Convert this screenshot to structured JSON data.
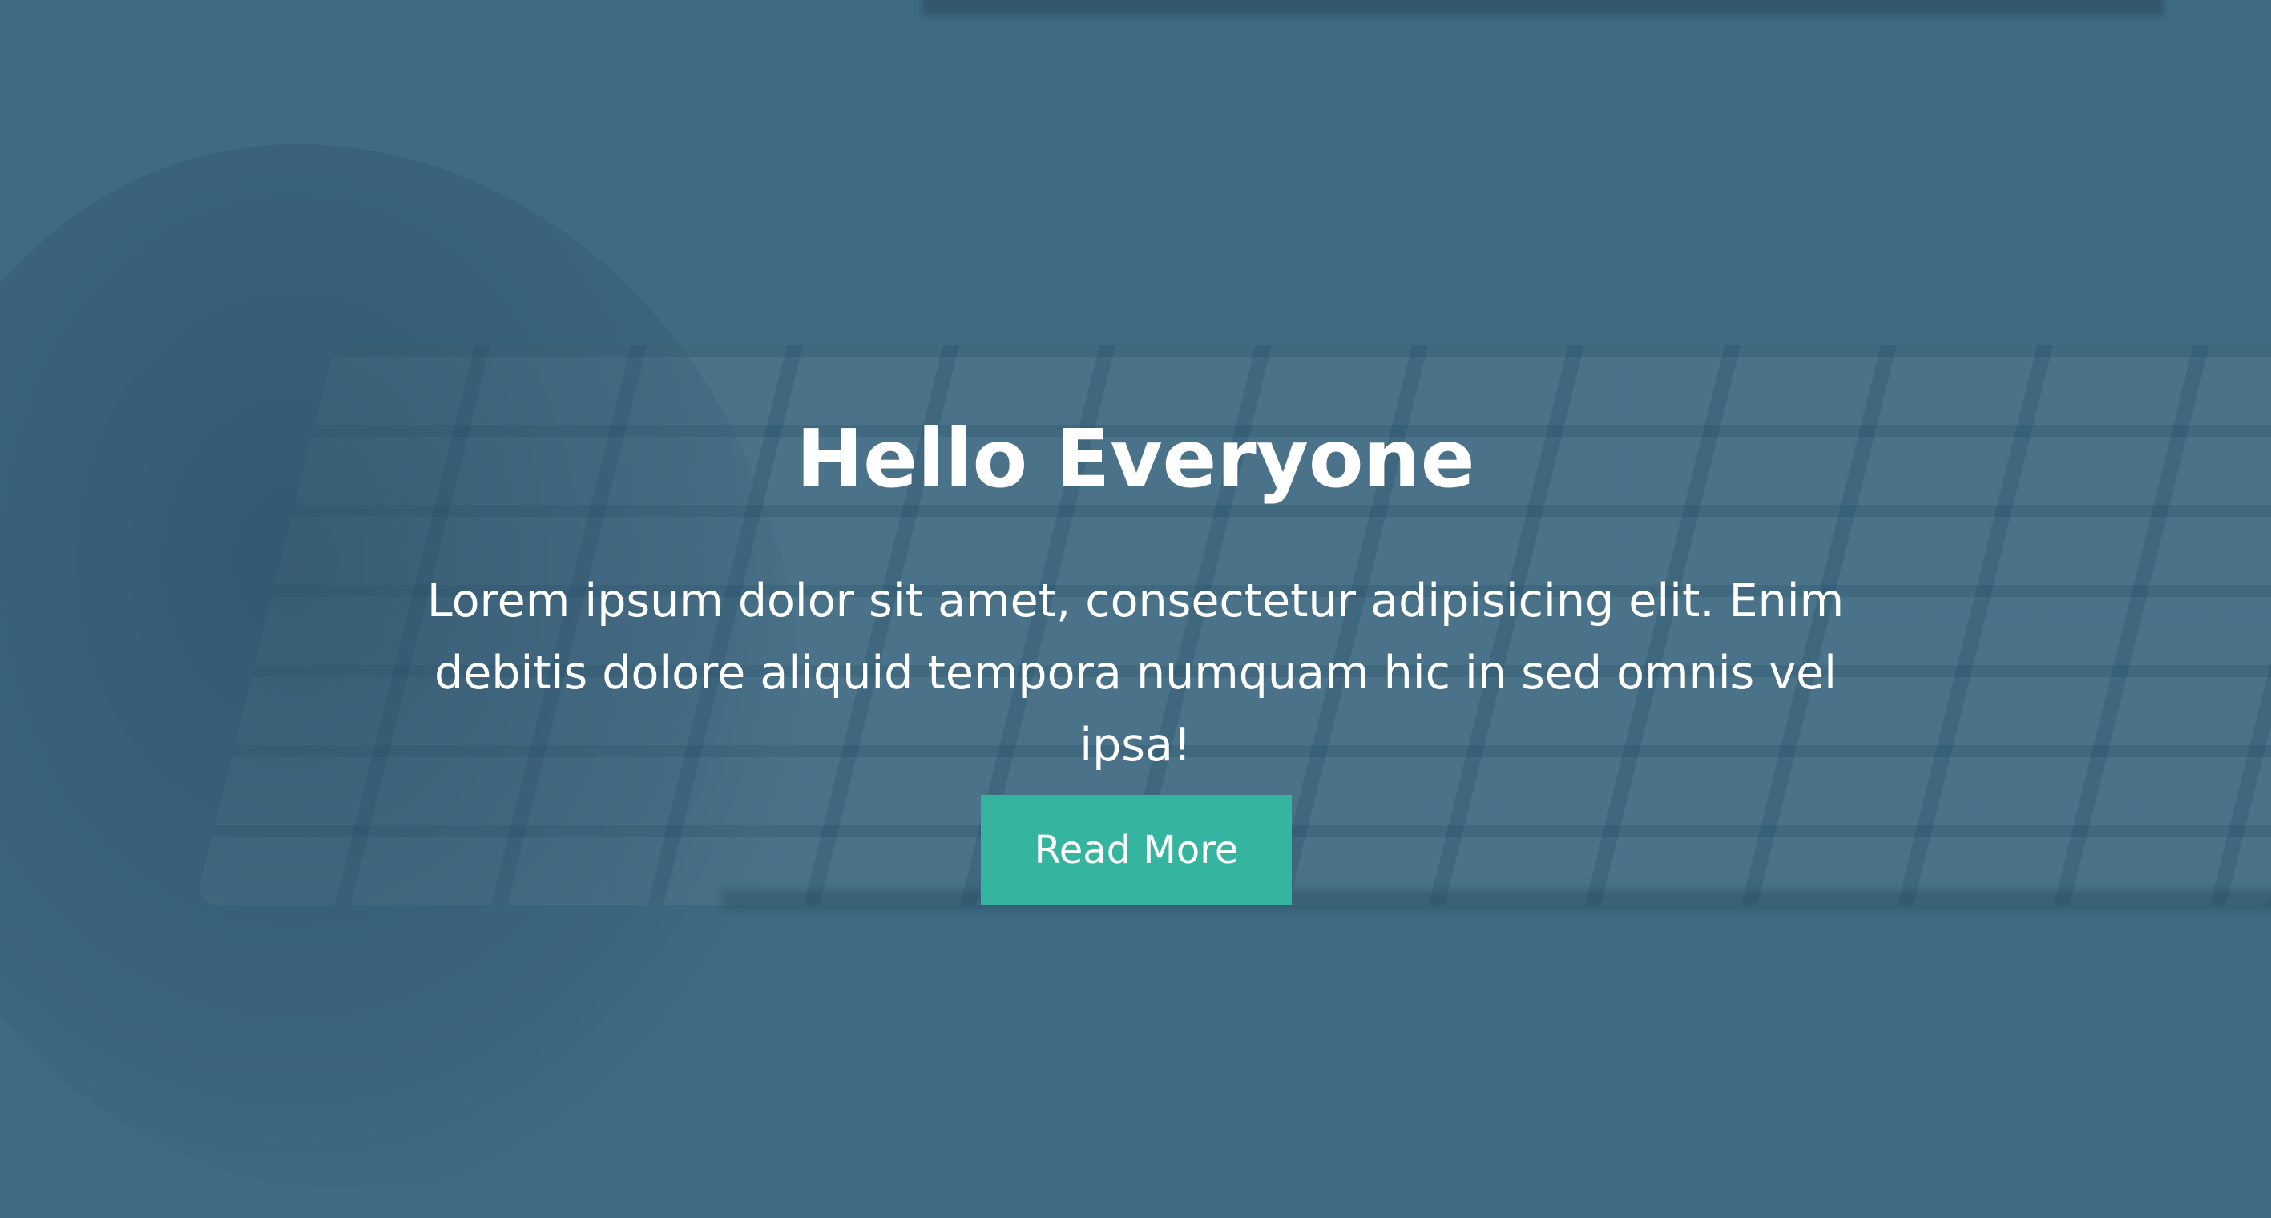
{
  "hero": {
    "title": "Hello Everyone",
    "description": "Lorem ipsum dolor sit amet, consectetur adipisicing elit. Enim debitis dolore aliquid tempora numquam hic in sed omnis vel ipsa!",
    "button_label": "Read More",
    "overlay_color": "#3e6a82",
    "button_color": "#35b59f"
  }
}
